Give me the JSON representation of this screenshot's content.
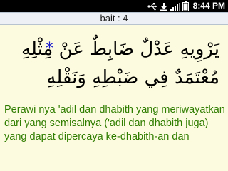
{
  "status_bar": {
    "time": "8:44 PM",
    "icons": [
      "usb-icon",
      "download-icon",
      "signal-icon",
      "battery-icon"
    ]
  },
  "title_bar": {
    "title": "bait : 4"
  },
  "bait": {
    "arabic_line_1": "يَرْوِيهِ عَدْلٌ ضَابِطٌ عَنْ مِثْلِهِ",
    "arabic_line_2": "مُعْتَمَدٌ فِي ضَبْطِهِ وَنَقْلِهِ",
    "marker": "*",
    "translation": "Perawi nya 'adil dan dhabith yang meriwayatkan dari yang semisalnya ('adil dan dhabith juga) yang dapat dipercaya ke-dhabith-an dan"
  },
  "colors": {
    "background": "#fdfbdf",
    "translation_text": "#2f7d00",
    "marker": "#1a1acc",
    "status_bar": "#000000",
    "title_bar": "#edf1f5"
  }
}
